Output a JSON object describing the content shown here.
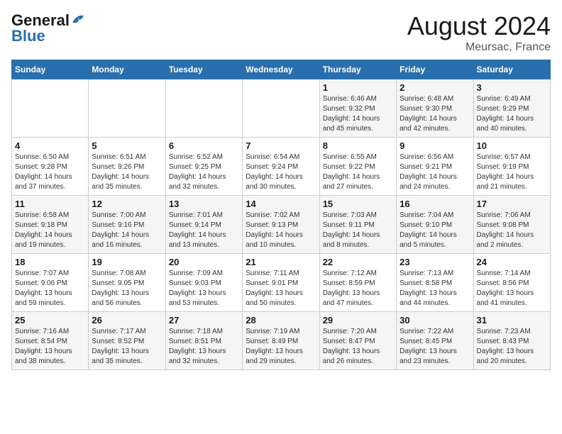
{
  "logo": {
    "line1": "General",
    "line2": "Blue",
    "bird_symbol": "▲"
  },
  "title": "August 2024",
  "subtitle": "Meursac, France",
  "days_of_week": [
    "Sunday",
    "Monday",
    "Tuesday",
    "Wednesday",
    "Thursday",
    "Friday",
    "Saturday"
  ],
  "weeks": [
    [
      {
        "day": "",
        "info": ""
      },
      {
        "day": "",
        "info": ""
      },
      {
        "day": "",
        "info": ""
      },
      {
        "day": "",
        "info": ""
      },
      {
        "day": "1",
        "info": "Sunrise: 6:46 AM\nSunset: 9:32 PM\nDaylight: 14 hours and 45 minutes."
      },
      {
        "day": "2",
        "info": "Sunrise: 6:48 AM\nSunset: 9:30 PM\nDaylight: 14 hours and 42 minutes."
      },
      {
        "day": "3",
        "info": "Sunrise: 6:49 AM\nSunset: 9:29 PM\nDaylight: 14 hours and 40 minutes."
      }
    ],
    [
      {
        "day": "4",
        "info": "Sunrise: 6:50 AM\nSunset: 9:28 PM\nDaylight: 14 hours and 37 minutes."
      },
      {
        "day": "5",
        "info": "Sunrise: 6:51 AM\nSunset: 9:26 PM\nDaylight: 14 hours and 35 minutes."
      },
      {
        "day": "6",
        "info": "Sunrise: 6:52 AM\nSunset: 9:25 PM\nDaylight: 14 hours and 32 minutes."
      },
      {
        "day": "7",
        "info": "Sunrise: 6:54 AM\nSunset: 9:24 PM\nDaylight: 14 hours and 30 minutes."
      },
      {
        "day": "8",
        "info": "Sunrise: 6:55 AM\nSunset: 9:22 PM\nDaylight: 14 hours and 27 minutes."
      },
      {
        "day": "9",
        "info": "Sunrise: 6:56 AM\nSunset: 9:21 PM\nDaylight: 14 hours and 24 minutes."
      },
      {
        "day": "10",
        "info": "Sunrise: 6:57 AM\nSunset: 9:19 PM\nDaylight: 14 hours and 21 minutes."
      }
    ],
    [
      {
        "day": "11",
        "info": "Sunrise: 6:58 AM\nSunset: 9:18 PM\nDaylight: 14 hours and 19 minutes."
      },
      {
        "day": "12",
        "info": "Sunrise: 7:00 AM\nSunset: 9:16 PM\nDaylight: 14 hours and 16 minutes."
      },
      {
        "day": "13",
        "info": "Sunrise: 7:01 AM\nSunset: 9:14 PM\nDaylight: 14 hours and 13 minutes."
      },
      {
        "day": "14",
        "info": "Sunrise: 7:02 AM\nSunset: 9:13 PM\nDaylight: 14 hours and 10 minutes."
      },
      {
        "day": "15",
        "info": "Sunrise: 7:03 AM\nSunset: 9:11 PM\nDaylight: 14 hours and 8 minutes."
      },
      {
        "day": "16",
        "info": "Sunrise: 7:04 AM\nSunset: 9:10 PM\nDaylight: 14 hours and 5 minutes."
      },
      {
        "day": "17",
        "info": "Sunrise: 7:06 AM\nSunset: 9:08 PM\nDaylight: 14 hours and 2 minutes."
      }
    ],
    [
      {
        "day": "18",
        "info": "Sunrise: 7:07 AM\nSunset: 9:06 PM\nDaylight: 13 hours and 59 minutes."
      },
      {
        "day": "19",
        "info": "Sunrise: 7:08 AM\nSunset: 9:05 PM\nDaylight: 13 hours and 56 minutes."
      },
      {
        "day": "20",
        "info": "Sunrise: 7:09 AM\nSunset: 9:03 PM\nDaylight: 13 hours and 53 minutes."
      },
      {
        "day": "21",
        "info": "Sunrise: 7:11 AM\nSunset: 9:01 PM\nDaylight: 13 hours and 50 minutes."
      },
      {
        "day": "22",
        "info": "Sunrise: 7:12 AM\nSunset: 8:59 PM\nDaylight: 13 hours and 47 minutes."
      },
      {
        "day": "23",
        "info": "Sunrise: 7:13 AM\nSunset: 8:58 PM\nDaylight: 13 hours and 44 minutes."
      },
      {
        "day": "24",
        "info": "Sunrise: 7:14 AM\nSunset: 8:56 PM\nDaylight: 13 hours and 41 minutes."
      }
    ],
    [
      {
        "day": "25",
        "info": "Sunrise: 7:16 AM\nSunset: 8:54 PM\nDaylight: 13 hours and 38 minutes."
      },
      {
        "day": "26",
        "info": "Sunrise: 7:17 AM\nSunset: 8:52 PM\nDaylight: 13 hours and 35 minutes."
      },
      {
        "day": "27",
        "info": "Sunrise: 7:18 AM\nSunset: 8:51 PM\nDaylight: 13 hours and 32 minutes."
      },
      {
        "day": "28",
        "info": "Sunrise: 7:19 AM\nSunset: 8:49 PM\nDaylight: 13 hours and 29 minutes."
      },
      {
        "day": "29",
        "info": "Sunrise: 7:20 AM\nSunset: 8:47 PM\nDaylight: 13 hours and 26 minutes."
      },
      {
        "day": "30",
        "info": "Sunrise: 7:22 AM\nSunset: 8:45 PM\nDaylight: 13 hours and 23 minutes."
      },
      {
        "day": "31",
        "info": "Sunrise: 7:23 AM\nSunset: 8:43 PM\nDaylight: 13 hours and 20 minutes."
      }
    ]
  ]
}
